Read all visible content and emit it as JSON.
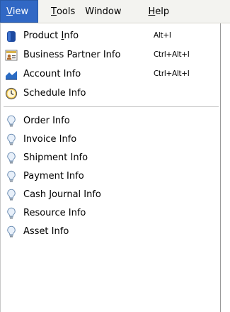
{
  "menubar": {
    "items": [
      {
        "label_first": "V",
        "label_rest": "iew"
      },
      {
        "label_first": "T",
        "label_rest": "ools"
      },
      {
        "label": "Window"
      },
      {
        "label_first": "H",
        "label_rest": "elp"
      }
    ]
  },
  "menu": {
    "top_items": [
      {
        "label_pre": "Product ",
        "label_u": "I",
        "label_post": "nfo",
        "shortcut": "Alt+I",
        "icon": "product-icon"
      },
      {
        "label": "Business Partner Info",
        "shortcut": "Ctrl+Alt+I",
        "icon": "business-partner-icon"
      },
      {
        "label": "Account Info",
        "shortcut": "Ctrl+Alt+I",
        "icon": "account-icon"
      },
      {
        "label": "Schedule Info",
        "shortcut": "",
        "icon": "schedule-icon"
      }
    ],
    "info_items": [
      {
        "label": "Order Info",
        "icon": "lightbulb-icon"
      },
      {
        "label": "Invoice Info",
        "icon": "lightbulb-icon"
      },
      {
        "label": "Shipment Info",
        "icon": "lightbulb-icon"
      },
      {
        "label": "Payment Info",
        "icon": "lightbulb-icon"
      },
      {
        "label": "Cash Journal Info",
        "icon": "lightbulb-icon"
      },
      {
        "label": "Resource Info",
        "icon": "lightbulb-icon"
      },
      {
        "label": "Asset Info",
        "icon": "lightbulb-icon"
      }
    ]
  },
  "colors": {
    "menubar_bg": "#f3f3f0",
    "active_menu_bg": "#3168c5",
    "active_menu_text": "#ffffff"
  }
}
